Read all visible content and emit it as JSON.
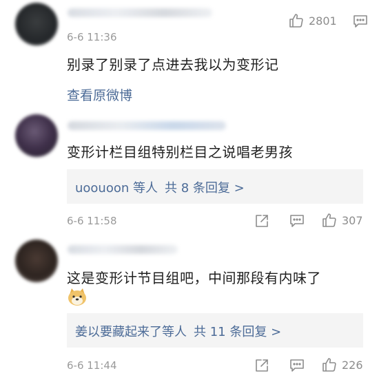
{
  "comments": [
    {
      "time": "6-6 11:36",
      "text": "别录了别录了点进去我以为变形记",
      "like_count": "2801",
      "view_original": "查看原微博"
    },
    {
      "text": "变形计栏目组特别栏目之说唱老男孩",
      "reply_users": "uoouoon 等人",
      "reply_count": "共 8 条回复 >",
      "time": "6-6 11:58",
      "like_count": "307"
    },
    {
      "text": "这是变形计节目组吧，中间那段有内味了",
      "reply_users": "姜以要藏起来了等人",
      "reply_count": "共 11 条回复 >",
      "time": "6-6 11:44",
      "like_count": "226"
    }
  ],
  "icons": {
    "like": "thumbs-up-icon",
    "comment": "comment-icon",
    "share": "share-icon"
  },
  "colors": {
    "link": "#4c6b97",
    "reply_bg": "#f4f4f4",
    "meta": "#9a9a9a"
  }
}
